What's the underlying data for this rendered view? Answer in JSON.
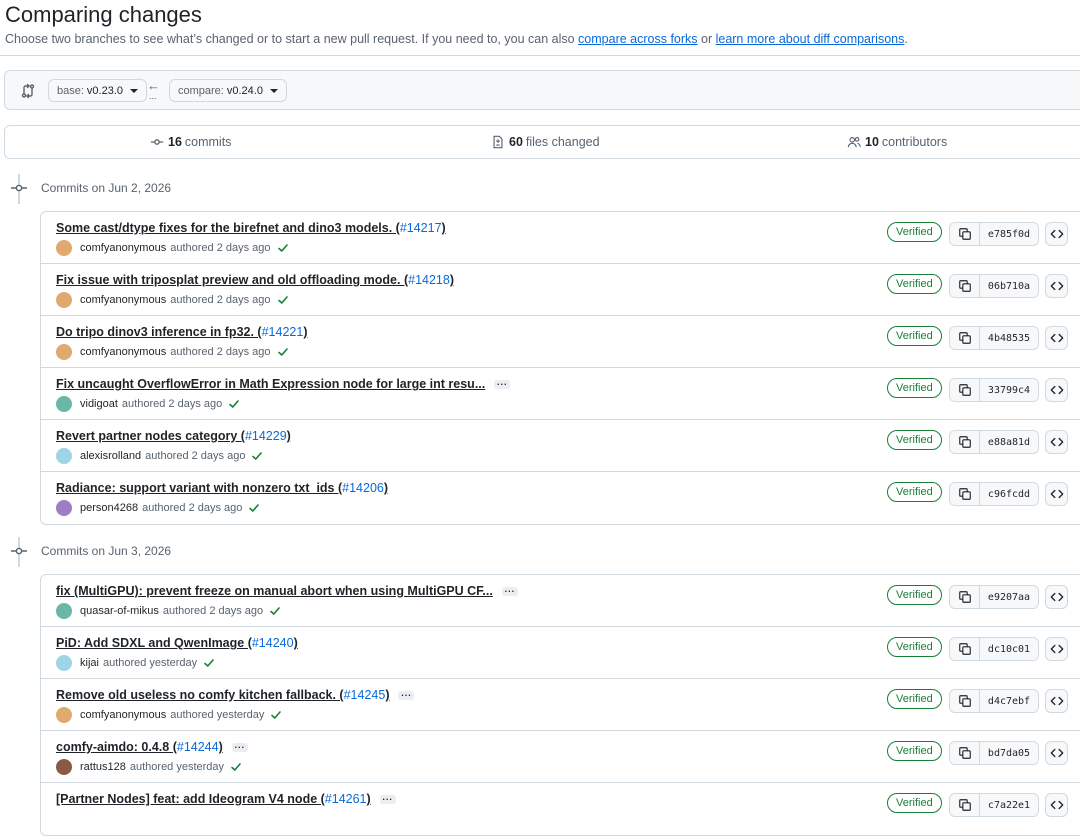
{
  "page": {
    "title": "Comparing changes",
    "subtitle_before": "Choose two branches to see what’s changed or to start a new pull request. If you need to, you can also ",
    "link_forks": "compare across forks",
    "subtitle_mid": " or ",
    "link_learn": "learn more about diff comparisons",
    "subtitle_end": "."
  },
  "range": {
    "base_label": "base:",
    "base_value": "v0.23.0",
    "compare_label": "compare:",
    "compare_value": "v0.24.0",
    "arrow": "←",
    "dots": "..."
  },
  "summary": {
    "commits_count": "16",
    "commits_label": "commits",
    "files_count": "60",
    "files_label": "files changed",
    "contributors_count": "10",
    "contributors_label": "contributors"
  },
  "icons": {
    "range": "git-compare-icon",
    "commits": "git-commit-icon",
    "files": "file-diff-icon",
    "contributors": "people-icon",
    "copy": "copy-icon",
    "browse": "code-icon",
    "check": "check-icon",
    "ellipsis": "ellipsis-icon"
  },
  "colors": {
    "link": "#0969da",
    "verified": "#1a7f37",
    "border": "#d1d9e0",
    "muted": "#59636e",
    "text": "#1f2328"
  },
  "groups": [
    {
      "title": "Commits on Jun 2, 2026",
      "commits": [
        {
          "message": "Some cast/dtype fixes for the birefnet and dino3 models. (",
          "pr": "#14217",
          "close": ")",
          "truncated": false,
          "author": "comfyanonymous",
          "when": "authored 2 days ago",
          "badge": "Verified",
          "sha": "e785f0d"
        },
        {
          "message": "Fix issue with triposplat preview and old offloading mode. (",
          "pr": "#14218",
          "close": ")",
          "truncated": false,
          "author": "comfyanonymous",
          "when": "authored 2 days ago",
          "badge": "Verified",
          "sha": "06b710a"
        },
        {
          "message": "Do tripo dinov3 inference in fp32. (",
          "pr": "#14221",
          "close": ")",
          "truncated": false,
          "author": "comfyanonymous",
          "when": "authored 2 days ago",
          "badge": "Verified",
          "sha": "4b48535"
        },
        {
          "message": "Fix uncaught OverflowError in Math Expression node for large int resu...",
          "pr": "",
          "close": "",
          "truncated": true,
          "author": "vidigoat",
          "when": "authored 2 days ago",
          "badge": "Verified",
          "sha": "33799c4"
        },
        {
          "message": "Revert partner nodes category (",
          "pr": "#14229",
          "close": ")",
          "truncated": false,
          "author": "alexisrolland",
          "when": "authored 2 days ago",
          "badge": "Verified",
          "sha": "e88a81d"
        },
        {
          "message": "Radiance: support variant with nonzero txt_ids (",
          "pr": "#14206",
          "close": ")",
          "truncated": false,
          "author": "person4268",
          "when": "authored 2 days ago",
          "badge": "Verified",
          "sha": "c96fcdd"
        }
      ]
    },
    {
      "title": "Commits on Jun 3, 2026",
      "commits": [
        {
          "message": "fix (MultiGPU): prevent freeze on manual abort when using MultiGPU CF...",
          "pr": "",
          "close": "",
          "truncated": true,
          "author": "quasar-of-mikus",
          "when": "authored 2 days ago",
          "badge": "Verified",
          "sha": "e9207aa"
        },
        {
          "message": "PiD: Add SDXL and QwenImage (",
          "pr": "#14240",
          "close": ")",
          "truncated": false,
          "author": "kijai",
          "when": "authored yesterday",
          "badge": "Verified",
          "sha": "dc10c01"
        },
        {
          "message": "Remove old useless no comfy kitchen fallback. (",
          "pr": "#14245",
          "close": ")",
          "truncated": true,
          "author": "comfyanonymous",
          "when": "authored yesterday",
          "badge": "Verified",
          "sha": "d4c7ebf"
        },
        {
          "message": "comfy-aimdo: 0.4.8 (",
          "pr": "#14244",
          "close": ")",
          "truncated": true,
          "author": "rattus128",
          "when": "authored yesterday",
          "badge": "Verified",
          "sha": "bd7da05"
        },
        {
          "message": "[Partner Nodes] feat: add Ideogram V4 node (",
          "pr": "#14261",
          "close": ")",
          "truncated": true,
          "author": "",
          "when": "",
          "badge": "Verified",
          "sha": "c7a22e1"
        }
      ]
    }
  ]
}
